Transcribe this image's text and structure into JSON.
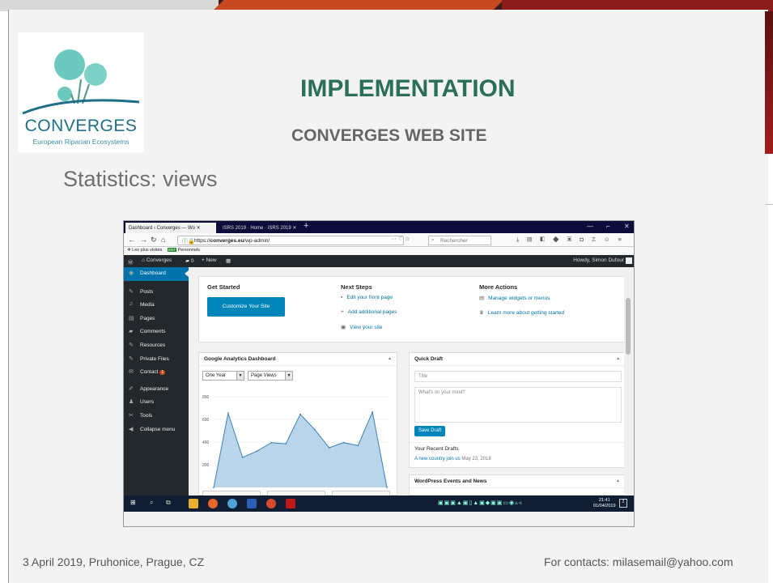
{
  "slide": {
    "logo_name": "CONVERGES",
    "logo_sub": "European Riparian Ecosystems",
    "title": "IMPLEMENTATION",
    "subtitle": "CONVERGES WEB SITE",
    "section_heading": "Statistics: views",
    "footer_left": "3 April 2019,  Pruhonice, Prague, CZ",
    "footer_right": "For contacts: milasemail@yahoo.com"
  },
  "browser": {
    "tabs": [
      {
        "label": "Dashboard ‹ Converges — Wo"
      },
      {
        "label": "ISRS 2019 · Home · ISRS 2019"
      }
    ],
    "url_prefix": "https://",
    "url_host": "converges.eu",
    "url_path": "/wp-admin/",
    "url_actions": "··· ♡ ☆",
    "search_placeholder": "Rechercher",
    "bookmarks": {
      "most_visited": "Les plus visités",
      "ent_badge": "ENT",
      "ent_label": "Personnels"
    }
  },
  "adminbar": {
    "site": "Converges",
    "comments": "0",
    "new": "New",
    "howdy": "Howdy, Simon Dufour"
  },
  "sidebar": {
    "items": [
      {
        "label": "Dashboard",
        "icon": "dashboard-icon",
        "glyph": "◉",
        "active": true
      },
      {
        "label": "Posts",
        "icon": "pin-icon",
        "glyph": "✎"
      },
      {
        "label": "Media",
        "icon": "media-icon",
        "glyph": "♫"
      },
      {
        "label": "Pages",
        "icon": "page-icon",
        "glyph": "▤"
      },
      {
        "label": "Comments",
        "icon": "comment-icon",
        "glyph": "▰"
      },
      {
        "label": "Resources",
        "icon": "pin-icon",
        "glyph": "✎"
      },
      {
        "label": "Private Files",
        "icon": "pin-icon",
        "glyph": "✎"
      },
      {
        "label": "Contact",
        "icon": "mail-icon",
        "glyph": "✉",
        "badge": "1"
      },
      {
        "label": "Appearance",
        "icon": "brush-icon",
        "glyph": "✐"
      },
      {
        "label": "Users",
        "icon": "user-icon",
        "glyph": "♟"
      },
      {
        "label": "Tools",
        "icon": "wrench-icon",
        "glyph": "✂"
      },
      {
        "label": "Collapse menu",
        "icon": "collapse-icon",
        "glyph": "◀"
      }
    ]
  },
  "welcome": {
    "get_started": "Get Started",
    "customize_button": "Customize Your Site",
    "next_steps": "Next Steps",
    "next_links": [
      "Edit your front page",
      "Add additional pages",
      "View your site"
    ],
    "more_actions": "More Actions",
    "more_links": [
      "Manage widgets or menus",
      "Learn more about getting started"
    ]
  },
  "ga": {
    "title": "Google Analytics Dashboard",
    "period": "One Year",
    "metric": "Page Views"
  },
  "chart_data": {
    "type": "area",
    "x": [
      1,
      2,
      3,
      4,
      5,
      6,
      7,
      8,
      9,
      10,
      11,
      12,
      13
    ],
    "values": [
      0,
      655,
      265,
      320,
      395,
      385,
      645,
      510,
      350,
      395,
      370,
      665,
      0
    ],
    "ylim": [
      0,
      800
    ],
    "yticks": [
      200,
      400,
      600,
      800
    ],
    "fill_color": "#bad5ea",
    "line_color": "#3c81b6"
  },
  "quick_draft": {
    "title": "Quick Draft",
    "title_placeholder": "Title",
    "content_placeholder": "What's on your mind?",
    "save_button": "Save Draft",
    "recent_heading": "Your Recent Drafts",
    "draft_title": "A new country join us",
    "draft_date": "May 23, 2018"
  },
  "events": {
    "title": "WordPress Events and News"
  },
  "taskbar": {
    "time": "21:41",
    "date": "01/04/2019",
    "notifications": "2"
  }
}
